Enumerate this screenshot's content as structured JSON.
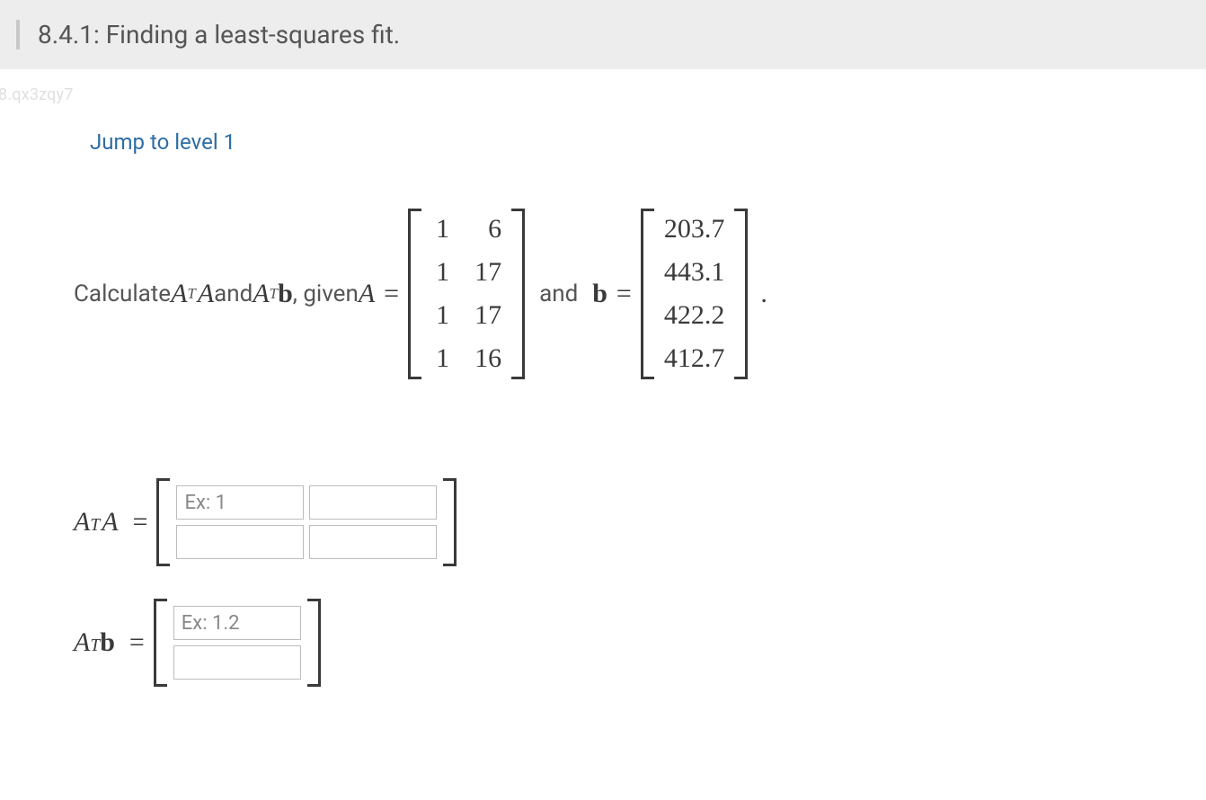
{
  "header": {
    "title": "8.4.1: Finding a least-squares fit."
  },
  "watermark": "8.qx3zqy7",
  "jump_link": "Jump to level 1",
  "problem": {
    "prefix": "Calculate ",
    "term1_A": "A",
    "term1_T": "T",
    "term1_A2": "A",
    "and1": " and ",
    "term2_A": "A",
    "term2_T": "T",
    "term2_b": "b",
    "given": ", given ",
    "A_sym": "A",
    "eq": "=",
    "and2": " and ",
    "b_sym": "b",
    "period": ".",
    "matrixA": [
      [
        "1",
        "6"
      ],
      [
        "1",
        "17"
      ],
      [
        "1",
        "17"
      ],
      [
        "1",
        "16"
      ]
    ],
    "vectorB": [
      "203.7",
      "443.1",
      "422.2",
      "412.7"
    ]
  },
  "answers": {
    "ata": {
      "label_A1": "A",
      "label_T": "T",
      "label_A2": "A",
      "eq": "=",
      "placeholders": [
        "Ex: 1",
        "",
        "",
        ""
      ]
    },
    "atb": {
      "label_A": "A",
      "label_T": "T",
      "label_b": "b",
      "eq": "=",
      "placeholders": [
        "Ex: 1.2",
        ""
      ]
    }
  }
}
